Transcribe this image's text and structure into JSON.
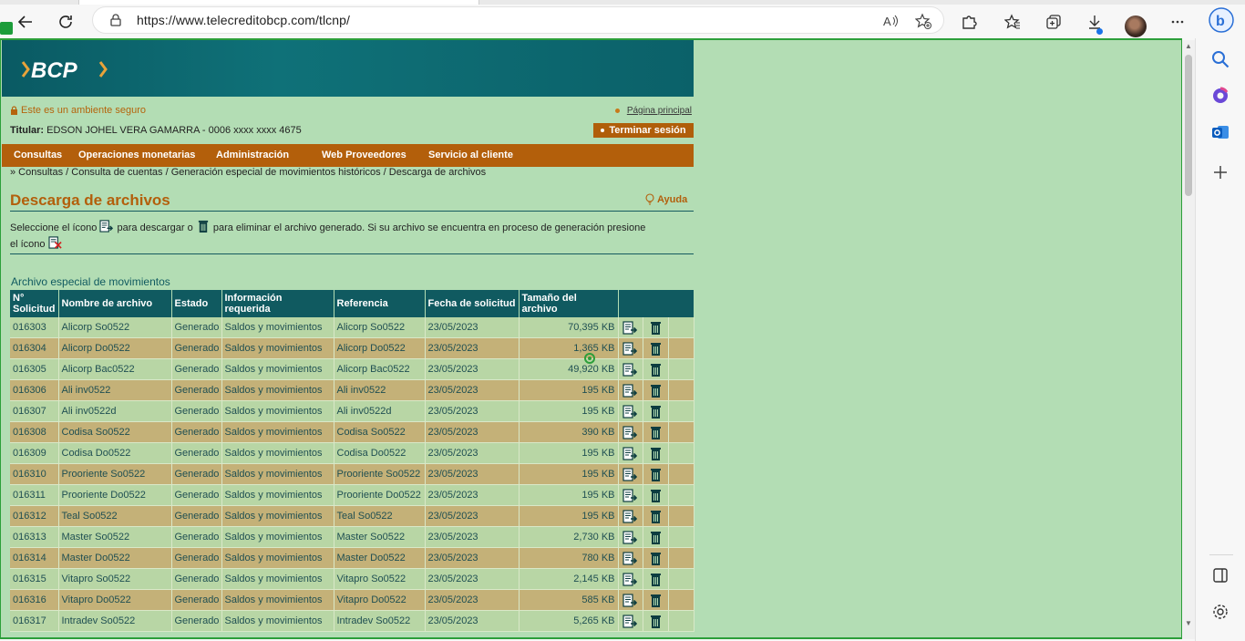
{
  "browser": {
    "url": "https://www.telecreditobcp.com/tlcnp/"
  },
  "page": {
    "logo_text": "BCP",
    "secure_text": "Este es un ambiente seguro",
    "home_link": "Página principal",
    "titular_label": "Titular:",
    "titular_value": "EDSON JOHEL VERA GAMARRA - 0006 xxxx xxxx 4675",
    "logout": "Terminar sesión",
    "nav": [
      "Consultas",
      "Operaciones monetarias",
      "Administración",
      "Web Proveedores",
      "Servicio al cliente"
    ],
    "breadcrumb": "» Consultas / Consulta de cuentas / Generación especial de movimientos históricos / Descarga de archivos",
    "title": "Descarga de archivos",
    "help": "Ayuda",
    "instructions_1": "Seleccione el ícono",
    "instructions_2": "para descargar o",
    "instructions_3": "para eliminar el archivo generado. Si su archivo se encuentra en proceso de generación presione el ícono",
    "section_title": "Archivo especial de movimientos"
  },
  "table": {
    "headers": [
      "N° Solicitud",
      "Nombre de archivo",
      "Estado",
      "Información requerida",
      "Referencia",
      "Fecha de solicitud",
      "Tamaño del archivo"
    ],
    "rows": [
      [
        "016303",
        "Alicorp So0522",
        "Generado",
        "Saldos y movimientos",
        "Alicorp So0522",
        "23/05/2023",
        "70,395 KB"
      ],
      [
        "016304",
        "Alicorp Do0522",
        "Generado",
        "Saldos y movimientos",
        "Alicorp Do0522",
        "23/05/2023",
        "1,365 KB"
      ],
      [
        "016305",
        "Alicorp Bac0522",
        "Generado",
        "Saldos y movimientos",
        "Alicorp Bac0522",
        "23/05/2023",
        "49,920 KB"
      ],
      [
        "016306",
        "Ali inv0522",
        "Generado",
        "Saldos y movimientos",
        "Ali inv0522",
        "23/05/2023",
        "195 KB"
      ],
      [
        "016307",
        "Ali inv0522d",
        "Generado",
        "Saldos y movimientos",
        "Ali inv0522d",
        "23/05/2023",
        "195 KB"
      ],
      [
        "016308",
        "Codisa So0522",
        "Generado",
        "Saldos y movimientos",
        "Codisa So0522",
        "23/05/2023",
        "390 KB"
      ],
      [
        "016309",
        "Codisa Do0522",
        "Generado",
        "Saldos y movimientos",
        "Codisa Do0522",
        "23/05/2023",
        "195 KB"
      ],
      [
        "016310",
        "Prooriente So0522",
        "Generado",
        "Saldos y movimientos",
        "Prooriente So0522",
        "23/05/2023",
        "195 KB"
      ],
      [
        "016311",
        "Prooriente Do0522",
        "Generado",
        "Saldos y movimientos",
        "Prooriente Do0522",
        "23/05/2023",
        "195 KB"
      ],
      [
        "016312",
        "Teal So0522",
        "Generado",
        "Saldos y movimientos",
        "Teal So0522",
        "23/05/2023",
        "195 KB"
      ],
      [
        "016313",
        "Master So0522",
        "Generado",
        "Saldos y movimientos",
        "Master So0522",
        "23/05/2023",
        "2,730 KB"
      ],
      [
        "016314",
        "Master Do0522",
        "Generado",
        "Saldos y movimientos",
        "Master Do0522",
        "23/05/2023",
        "780 KB"
      ],
      [
        "016315",
        "Vitapro So0522",
        "Generado",
        "Saldos y movimientos",
        "Vitapro So0522",
        "23/05/2023",
        "2,145 KB"
      ],
      [
        "016316",
        "Vitapro Do0522",
        "Generado",
        "Saldos y movimientos",
        "Vitapro Do0522",
        "23/05/2023",
        "585 KB"
      ],
      [
        "016317",
        "Intradev So0522",
        "Generado",
        "Saldos y movimientos",
        "Intradev So0522",
        "23/05/2023",
        "5,265 KB"
      ]
    ]
  },
  "icons": {
    "download": "download-file-icon",
    "delete": "trash-icon",
    "cancel": "cancel-generation-icon"
  },
  "colors": {
    "page_bg": "#b3ddb4",
    "header_teal": "#0f7178",
    "nav_orange": "#b35f0b",
    "table_header": "#105a60",
    "row_odd": "#b8d6a5",
    "row_even": "#c4b178"
  }
}
